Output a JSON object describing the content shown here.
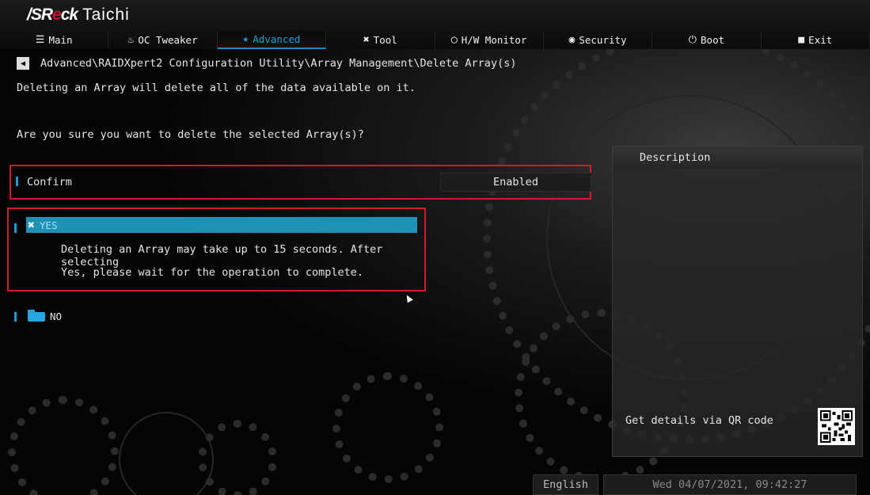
{
  "brand": {
    "name_prefix": "/SR",
    "name_mid": "e",
    "name_suffix": "ck",
    "model": "Taichi"
  },
  "tabs": [
    {
      "label": "Main",
      "icon": "list-icon",
      "glyph": "☰"
    },
    {
      "label": "OC Tweaker",
      "icon": "flame-icon",
      "glyph": "♨"
    },
    {
      "label": "Advanced",
      "icon": "star-icon",
      "glyph": "★",
      "active": true
    },
    {
      "label": "Tool",
      "icon": "wrench-icon",
      "glyph": "✖"
    },
    {
      "label": "H/W Monitor",
      "icon": "monitor-icon",
      "glyph": "◯"
    },
    {
      "label": "Security",
      "icon": "shield-icon",
      "glyph": "◉"
    },
    {
      "label": "Boot",
      "icon": "power-icon",
      "glyph": "⏻"
    },
    {
      "label": "Exit",
      "icon": "exit-icon",
      "glyph": "■"
    }
  ],
  "breadcrumb": "Advanced\\RAIDXpert2 Configuration Utility\\Array Management\\Delete Array(s)",
  "warning": "Deleting an Array will delete all of the data available on it.",
  "question": "Are you sure you want to delete the selected Array(s)?",
  "confirm": {
    "label": "Confirm",
    "value": "Enabled"
  },
  "yes": {
    "label": "YES",
    "line1": "Deleting an Array may take up to 15 seconds. After selecting",
    "line2": "Yes, please wait for the operation to complete."
  },
  "no": {
    "label": "NO"
  },
  "description": {
    "title": "Description",
    "qr_label": "Get details via QR code"
  },
  "status": {
    "language": "English",
    "datetime": "Wed 04/07/2021, 09:42:27"
  },
  "colors": {
    "accent": "#1f92b3",
    "highlight_border": "#d3192c",
    "tab_active": "#21a0d8"
  }
}
